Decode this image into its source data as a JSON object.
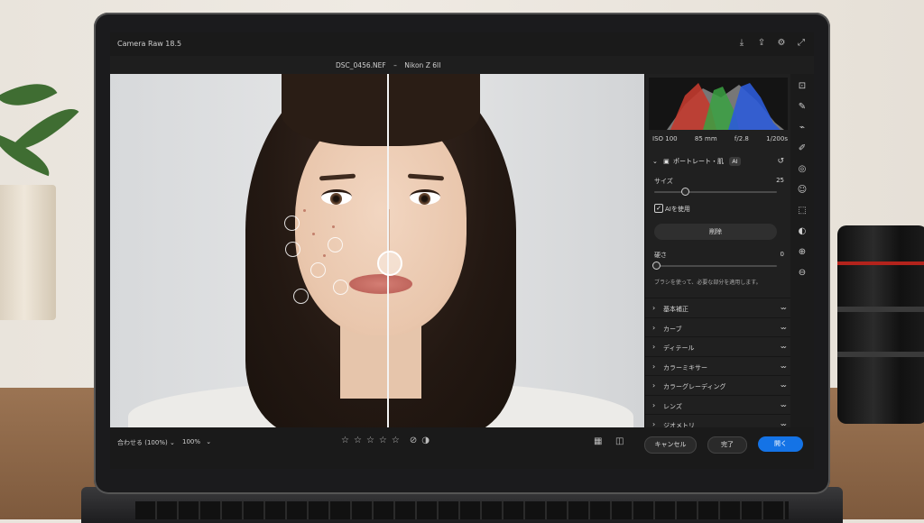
{
  "window": {
    "title": "Camera Raw 18.5"
  },
  "file": {
    "name": "DSC_0456.NEF",
    "separator": "–",
    "camera": "Nikon Z 6II"
  },
  "exif": {
    "iso": "ISO 100",
    "focal": "85 mm",
    "aperture": "f/2.8",
    "shutter": "1/200s"
  },
  "panel": {
    "section_title": "ポートレート・肌",
    "ai_badge": "AI",
    "size_label": "サイズ",
    "size_value": "25",
    "size_fraction": 0.25,
    "use_ai_label": "AIを使用",
    "use_ai_checked": true,
    "delete_label": "削除",
    "hardness_label": "硬さ",
    "hardness_value": "0",
    "hardness_fraction": 0,
    "hint": "ブラシを使って、必要な部分を適用します。",
    "accordion": [
      "基本補正",
      "カーブ",
      "ディテール",
      "カラーミキサー",
      "カラーグレーディング",
      "レンズ",
      "ジオメトリ"
    ]
  },
  "bottom": {
    "fit_label": "合わせる (100%)",
    "zoom_label": "100%",
    "cancel": "キャンセル",
    "done": "完了",
    "open": "開く"
  },
  "colors": {
    "accent": "#1473e6"
  },
  "icons": {
    "top": [
      "download-icon",
      "share-icon",
      "gear-icon",
      "fullscreen-icon"
    ],
    "tools": [
      "crop-icon",
      "heal-icon",
      "brush-icon",
      "pen-icon",
      "redeye-icon",
      "people-icon",
      "select-icon",
      "mask-icon",
      "zoom-in-icon",
      "zoom-out-icon"
    ]
  }
}
